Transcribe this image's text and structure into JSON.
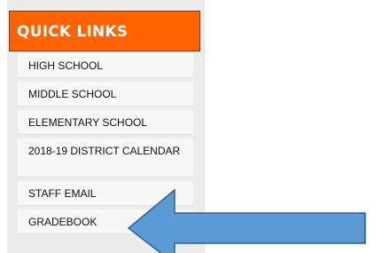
{
  "sidebar": {
    "title": "QUICK LINKS",
    "items": [
      {
        "label": "HIGH SCHOOL"
      },
      {
        "label": "MIDDLE SCHOOL"
      },
      {
        "label": "ELEMENTARY SCHOOL"
      },
      {
        "label": "2018-19 DISTRICT CALENDAR"
      },
      {
        "label": "STAFF EMAIL"
      },
      {
        "label": "GRADEBOOK"
      }
    ]
  },
  "colors": {
    "header_bg": "#ff6200",
    "sidebar_bg": "#ececec",
    "arrow_fill": "#5b9bd5",
    "arrow_stroke": "#2f5f8f"
  },
  "annotation": {
    "icon": "arrow-left-icon",
    "target": "GRADEBOOK"
  }
}
